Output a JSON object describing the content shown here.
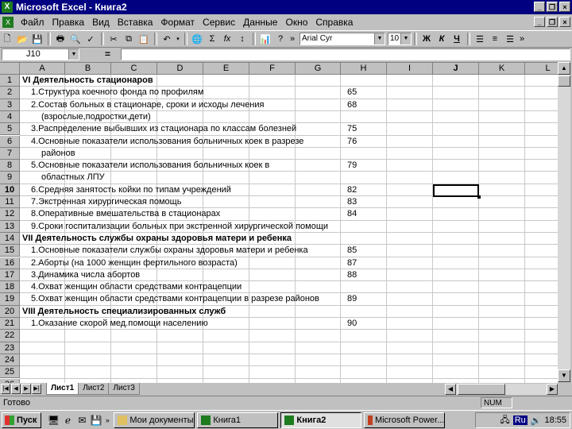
{
  "window": {
    "title": "Microsoft Excel - Книга2"
  },
  "menu": [
    "Файл",
    "Правка",
    "Вид",
    "Вставка",
    "Формат",
    "Сервис",
    "Данные",
    "Окно",
    "Справка"
  ],
  "toolbar": {
    "font_name": "Arial Cyr",
    "font_size": "10",
    "bold_label": "Ж",
    "italic_label": "К",
    "underline_label": "Ч",
    "sum_label": "Σ",
    "fx_label": "fx"
  },
  "formula_bar": {
    "name_box": "J10",
    "equals": "="
  },
  "columns": [
    "A",
    "B",
    "C",
    "D",
    "E",
    "F",
    "G",
    "H",
    "I",
    "J",
    "K",
    "L"
  ],
  "rows": [
    "1",
    "2",
    "3",
    "4",
    "5",
    "6",
    "7",
    "8",
    "9",
    "10",
    "11",
    "12",
    "13",
    "14",
    "15",
    "16",
    "17",
    "18",
    "19",
    "20",
    "21",
    "22",
    "23",
    "24",
    "25",
    "26"
  ],
  "cells": [
    {
      "row": "1",
      "text": "VI Деятельность стационаров",
      "bold": true,
      "indent": 0,
      "value": ""
    },
    {
      "row": "2",
      "text": "1.Структура коечного фонда по профилям",
      "bold": false,
      "indent": 1,
      "value": "65"
    },
    {
      "row": "3",
      "text": "2.Состав больных в стационаре, сроки и исходы лечения",
      "bold": false,
      "indent": 1,
      "value": "68"
    },
    {
      "row": "4",
      "text": "(взрослые,подростки,дети)",
      "bold": false,
      "indent": 2,
      "value": ""
    },
    {
      "row": "5",
      "text": "3.Распределение выбывших из стационара по классам болезней",
      "bold": false,
      "indent": 1,
      "value": "75"
    },
    {
      "row": "6",
      "text": "4.Основные показатели использования больничных коек в разрезе",
      "bold": false,
      "indent": 1,
      "value": "76"
    },
    {
      "row": "7",
      "text": "районов",
      "bold": false,
      "indent": 2,
      "value": ""
    },
    {
      "row": "8",
      "text": "5.Основные показатели использования больничных коек в",
      "bold": false,
      "indent": 1,
      "value": "79"
    },
    {
      "row": "9",
      "text": "областных ЛПУ",
      "bold": false,
      "indent": 2,
      "value": ""
    },
    {
      "row": "10",
      "text": "6.Средняя занятость койки по типам учреждений",
      "bold": false,
      "indent": 1,
      "value": "82"
    },
    {
      "row": "11",
      "text": "7.Экстренная хирургическая помощь",
      "bold": false,
      "indent": 1,
      "value": "83"
    },
    {
      "row": "12",
      "text": "8.Оперативные вмешательства в стационарах",
      "bold": false,
      "indent": 1,
      "value": "84"
    },
    {
      "row": "13",
      "text": "9.Сроки госпитализации больных при экстренной хирургической помощи",
      "bold": false,
      "indent": 1,
      "value": ""
    },
    {
      "row": "14",
      "text": "VII Деятельность службы охраны здоровья матери и ребенка",
      "bold": true,
      "indent": 0,
      "value": ""
    },
    {
      "row": "15",
      "text": "1.Основные показатели службы охраны здоровья матери и ребенка",
      "bold": false,
      "indent": 1,
      "value": "85"
    },
    {
      "row": "16",
      "text": "2.Аборты (на 1000 женщин фертильного возраста)",
      "bold": false,
      "indent": 1,
      "value": "87"
    },
    {
      "row": "17",
      "text": "3.Динамика числа абортов",
      "bold": false,
      "indent": 1,
      "value": "88"
    },
    {
      "row": "18",
      "text": "4.Охват женщин области средствами контрацепции",
      "bold": false,
      "indent": 1,
      "value": ""
    },
    {
      "row": "19",
      "text": "5.Охват женщин области средствами контрацепции в разрезе районов",
      "bold": false,
      "indent": 1,
      "value": "89"
    },
    {
      "row": "20",
      "text": "VIII Деятельность специализированных служб",
      "bold": true,
      "indent": 0,
      "value": ""
    },
    {
      "row": "21",
      "text": "1.Оказание скорой мед.помощи населению",
      "bold": false,
      "indent": 1,
      "value": "90"
    }
  ],
  "sheet_tabs": [
    "Лист1",
    "Лист2",
    "Лист3"
  ],
  "active_tab": "Лист1",
  "status": {
    "text": "Готово",
    "num": "NUM"
  },
  "taskbar": {
    "start": "Пуск",
    "buttons": [
      "Мои документы",
      "Книга1",
      "Книга2",
      "Microsoft Power..."
    ],
    "active_button": "Книга2",
    "lang": "Ru",
    "clock": "18:55"
  }
}
